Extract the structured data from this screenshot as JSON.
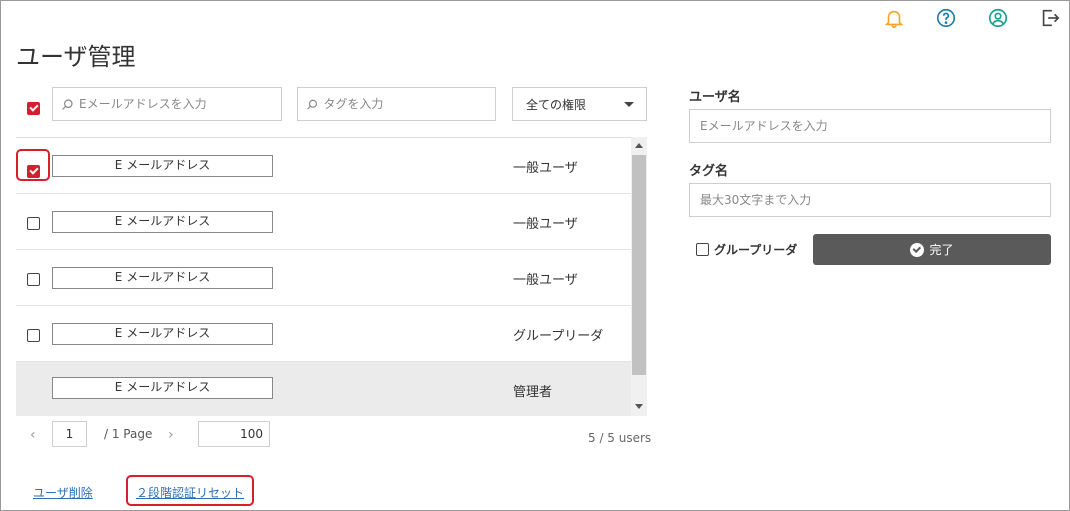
{
  "header": {
    "title": "ユーザ管理",
    "icons": [
      "bell-icon",
      "help-icon",
      "account-icon",
      "logout-icon"
    ],
    "icon_colors": {
      "bell": "#f5a623",
      "help": "#1a7fb0",
      "account": "#17a08c",
      "logout": "#444444"
    }
  },
  "filters": {
    "email_placeholder": "Eメールアドレスを入力",
    "tag_placeholder": "タグを入力",
    "role_selected": "全ての権限"
  },
  "users": [
    {
      "email": "E メールアドレス",
      "role": "一般ユーザ",
      "checked": true
    },
    {
      "email": "E メールアドレス",
      "role": "一般ユーザ",
      "checked": false
    },
    {
      "email": "E メールアドレス",
      "role": "一般ユーザ",
      "checked": false
    },
    {
      "email": "E メールアドレス",
      "role": "グループリーダ",
      "checked": false
    },
    {
      "email": "E メールアドレス",
      "role": "管理者",
      "checked": false
    }
  ],
  "pager": {
    "current_page": "1",
    "total_label": "/ 1 Page",
    "page_size": "100",
    "prev": "‹",
    "next": "›"
  },
  "count_label": "5 / 5 users",
  "actions": {
    "delete_user": "ユーザ削除",
    "reset_2fa": "２段階認証リセット"
  },
  "form": {
    "username_label": "ユーザ名",
    "username_placeholder": "Eメールアドレスを入力",
    "tag_label": "タグ名",
    "tag_placeholder": "最大30文字まで入力",
    "group_leader_label": "グループリーダ",
    "done_label": "完了"
  },
  "colors": {
    "accent": "#d71e2d",
    "link": "#2b6fb6",
    "button": "#5a5a5a"
  }
}
